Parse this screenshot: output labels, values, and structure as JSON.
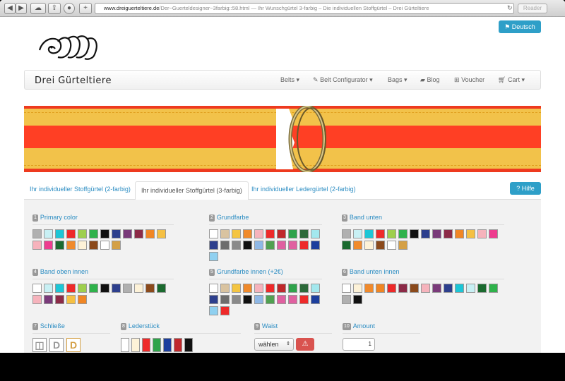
{
  "browser": {
    "url_domain": "www.dreiguerteltiere.de",
    "url_rest": "/Der~Guerteldesigner~3farbig::58.html — Ihr Wunschgürtel 3-farbig – Die individuellen Stoffgürtel – Drei Gürteltiere",
    "reader": "Reader"
  },
  "header": {
    "lang_button": "Deutsch",
    "brand": "Drei Gürteltiere"
  },
  "nav": {
    "belts": "Belts ▾",
    "configurator": "Belt Configurator ▾",
    "bags": "Bags ▾",
    "blog": "Blog",
    "voucher": "Voucher",
    "cart": "Cart ▾"
  },
  "tabs": {
    "tab1": "Ihr individueller Stoffgürtel (2-farbig)",
    "tab2": "Ihr individueller Stoffgürtel (3-farbig)",
    "tab3": "Ihr individueller Ledergürtel (2-farbig)",
    "help": "Hilfe"
  },
  "sections": [
    {
      "num": "1",
      "title": "Primary color",
      "swatches": [
        "#b0b0b0",
        "#c8f0f4",
        "#1cc6d6",
        "#ee2a2a",
        "#9ecf4d",
        "#2fb24b",
        "#111111",
        "#2d3f8d",
        "#7a3a7a",
        "#8c2a47",
        "#f08624",
        "#f5c043",
        "#f6b3bc",
        "#ee3c8f",
        "#1b6a2f",
        "#f08a2c",
        "#fdf2d8",
        "#8b4a1c",
        "#ffffff",
        "#d4a046"
      ]
    },
    {
      "num": "2",
      "title": "Grundfarbe",
      "swatches": [
        "#ffffff",
        "#d9c3a0",
        "#f4c542",
        "#f08a2c",
        "#f6b3bc",
        "#ee2a2a",
        "#c0282b",
        "#2fa34b",
        "#2d6a3a",
        "#a3e8ee",
        "#2d3f8d",
        "#6d6d6d",
        "#8a8a8a",
        "#111111",
        "#8fb8e6",
        "#50a050",
        "#e060a0",
        "#e060a0",
        "#ee2a2a",
        "#1d3f9d",
        "#8fd0f0"
      ]
    },
    {
      "num": "3",
      "title": "Band unten",
      "swatches": [
        "#b0b0b0",
        "#c8f0f4",
        "#1cc6d6",
        "#ee2a2a",
        "#9ecf4d",
        "#2fb24b",
        "#111111",
        "#2d3f8d",
        "#7a3a7a",
        "#8c2a47",
        "#f08624",
        "#f5c043",
        "#f6b3bc",
        "#ee3c8f",
        "#1b6a2f",
        "#f08a2c",
        "#fdf2d8",
        "#8b4a1c",
        "#ffffff",
        "#d4a046"
      ]
    },
    {
      "num": "4",
      "title": "Band oben innen",
      "swatches": [
        "#ffffff",
        "#c8f0f4",
        "#1cc6d6",
        "#ee2a2a",
        "#9ecf4d",
        "#2fb24b",
        "#111111",
        "#2d3f8d",
        "#b0b0b0",
        "#fdf2d8",
        "#8b4a1c",
        "#1b6a2f",
        "#f6b3bc",
        "#7a3a7a",
        "#8c2a47",
        "#f5c043",
        "#f08624"
      ]
    },
    {
      "num": "5",
      "title": "Grundfarbe innen (+2€)",
      "swatches": [
        "#ffffff",
        "#d9c3a0",
        "#f4c542",
        "#f08a2c",
        "#f6b3bc",
        "#ee2a2a",
        "#c0282b",
        "#2fa34b",
        "#2d6a3a",
        "#a3e8ee",
        "#2d3f8d",
        "#6d6d6d",
        "#8a8a8a",
        "#111111",
        "#8fb8e6",
        "#50a050",
        "#e060a0",
        "#e060a0",
        "#ee2a2a",
        "#1d3f9d",
        "#8fd0f0",
        "#ee2a2a"
      ]
    },
    {
      "num": "6",
      "title": "Band unten innen",
      "swatches": [
        "#ffffff",
        "#fdf2d8",
        "#f08a2c",
        "#f08624",
        "#ee2a2a",
        "#8c2a47",
        "#8b4a1c",
        "#f6b3bc",
        "#7a3a7a",
        "#2d3f8d",
        "#1cc6d6",
        "#c8f0f4",
        "#1b6a2f",
        "#2fb24b",
        "#b0b0b0",
        "#111111"
      ]
    }
  ],
  "bottom": {
    "clasp": {
      "num": "7",
      "title": "Schließe",
      "options": [
        "◫",
        "D",
        "D"
      ],
      "colors": [
        "#999999",
        "#999999",
        "#d4a046"
      ]
    },
    "leather": {
      "num": "8",
      "title": "Lederstück",
      "colors": [
        "#ffffff",
        "#fdf2d8",
        "#ee2a2a",
        "#2fa34b",
        "#1d3f9d",
        "#c0282b",
        "#111111"
      ]
    },
    "waist": {
      "num": "9",
      "title": "Waist",
      "select_value": "wählen",
      "warning_icon": "⚠"
    },
    "amount": {
      "num": "10",
      "title": "Amount",
      "value": "1"
    }
  }
}
